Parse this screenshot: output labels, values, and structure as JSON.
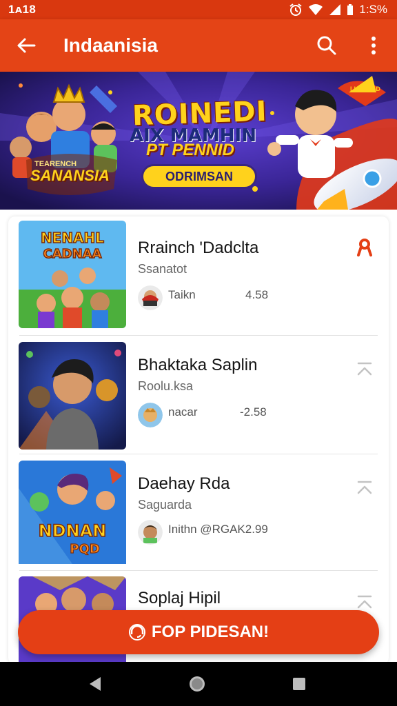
{
  "status_bar": {
    "time": "1ᴀ18",
    "battery": "1:S%"
  },
  "app_bar": {
    "title": "Indaanisia"
  },
  "banner": {
    "headline": "ROINEDI",
    "subline": "AIX MAMHIN",
    "subline2": "PT PENNID",
    "cta_label": "ODRIMSAN",
    "left_badge": "SANANSIA",
    "left_badge_small": "TEARENCH",
    "corner_tag": "LLAL LAD"
  },
  "items": [
    {
      "title": "Rrainch 'Dadclta",
      "subtitle": "Ssanatot",
      "user": "Taikn",
      "price": "4.58",
      "action_icon": "ribbon-icon"
    },
    {
      "title": "Bhaktaka Saplin",
      "subtitle": "Roolu.ksa",
      "user": "nacar",
      "price": "-2.58",
      "action_icon": "chevron-up-icon"
    },
    {
      "title": "Daehay Rda",
      "subtitle": "Saguarda",
      "user": "Inithn @RGAK2.99",
      "price": "",
      "action_icon": "chevron-up-icon"
    },
    {
      "title": "Soplaj Hipil",
      "subtitle": "",
      "user": "",
      "price": "",
      "action_icon": "chevron-up-icon"
    }
  ],
  "fab": {
    "label": "FOP PIDESAN!"
  },
  "colors": {
    "primary": "#e44416",
    "status": "#d9380f",
    "cta": "#ffd21c"
  }
}
